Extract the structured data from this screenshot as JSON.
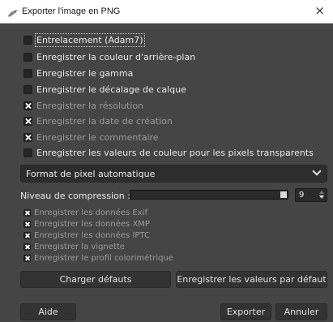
{
  "window": {
    "title": "Exporter l'image en PNG",
    "close_glyph": "×",
    "app_icon": "gimp-icon"
  },
  "options": [
    {
      "label": "Entrelacement (Adam7)",
      "checked": false,
      "enabled": true,
      "focused": true
    },
    {
      "label": "Enregistrer la couleur d'arrière-plan",
      "checked": false,
      "enabled": true
    },
    {
      "label": "Enregistrer le gamma",
      "checked": false,
      "enabled": true
    },
    {
      "label": "Enregistrer le décalage de calque",
      "checked": false,
      "enabled": true
    },
    {
      "label": "Enregistrer la résolution",
      "checked": true,
      "enabled": false
    },
    {
      "label": "Enregistrer la date de création",
      "checked": true,
      "enabled": false
    },
    {
      "label": "Enregistrer le commentaire",
      "checked": true,
      "enabled": false
    },
    {
      "label": "Enregistrer les valeurs de couleur pour les pixels transparents",
      "checked": false,
      "enabled": true
    }
  ],
  "pixel_format": {
    "selected": "Format de pixel automatique"
  },
  "compression": {
    "label": "Niveau de compression :",
    "value": "9",
    "level_fraction": 1.0
  },
  "metadata_options": [
    {
      "label": "Enregistrer les données Exif",
      "checked": true
    },
    {
      "label": "Enregistrer les données XMP",
      "checked": true
    },
    {
      "label": "Enregistrer les données IPTC",
      "checked": true
    },
    {
      "label": "Enregistrer la vignette",
      "checked": true
    },
    {
      "label": "Enregistrer le profil colorimétrique",
      "checked": true
    }
  ],
  "buttons": {
    "load_defaults": "Charger défauts",
    "save_defaults": "Enregistrer les valeurs par défaut",
    "help": "Aide",
    "export": "Exporter",
    "cancel": "Annuler"
  },
  "colors": {
    "dialog_bg": "#454545",
    "titlebar_bg": "#ffffff"
  }
}
